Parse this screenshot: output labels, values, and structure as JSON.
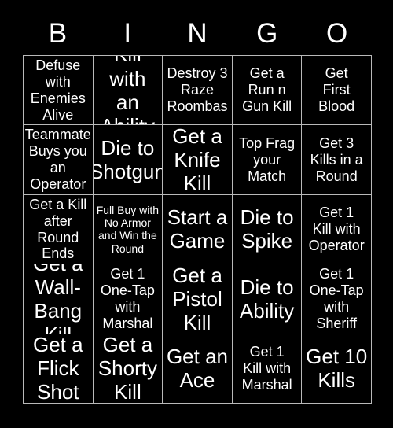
{
  "card": {
    "header_letters": [
      "B",
      "I",
      "N",
      "G",
      "O"
    ],
    "background_color": "#000000",
    "text_color": "#ffffff",
    "border_color": "#b9b9b9",
    "rows": 5,
    "columns": 5,
    "cells": [
      {
        "text": "Defuse\nwith\nEnemies\nAlive",
        "size": "sz-md"
      },
      {
        "text": "Kill with\nan\nAbility",
        "size": "sz-lg"
      },
      {
        "text": "Destroy 3\nRaze\nRoombas",
        "size": "sz-md"
      },
      {
        "text": "Get a\nRun n\nGun Kill",
        "size": "sz-md"
      },
      {
        "text": "Get\nFirst\nBlood",
        "size": "sz-md"
      },
      {
        "text": "Teammate\nBuys you\nan\nOperator",
        "size": "sz-md"
      },
      {
        "text": "Die to\nShotgun",
        "size": "sz-lg"
      },
      {
        "text": "Get a\nKnife\nKill",
        "size": "sz-lg"
      },
      {
        "text": "Top Frag\nyour\nMatch",
        "size": "sz-md"
      },
      {
        "text": "Get 3\nKills in a\nRound",
        "size": "sz-md"
      },
      {
        "text": "Get a Kill\nafter\nRound\nEnds",
        "size": "sz-md"
      },
      {
        "text": "Full Buy with\nNo Armor\nand Win the\nRound",
        "size": "sz-sm"
      },
      {
        "text": "Start a\nGame",
        "size": "sz-lg"
      },
      {
        "text": "Die to\nSpike",
        "size": "sz-lg"
      },
      {
        "text": "Get 1\nKill with\nOperator",
        "size": "sz-md"
      },
      {
        "text": "Get a\nWall-\nBang Kill",
        "size": "sz-lg"
      },
      {
        "text": "Get 1\nOne-Tap\nwith\nMarshal",
        "size": "sz-md"
      },
      {
        "text": "Get a\nPistol\nKill",
        "size": "sz-lg"
      },
      {
        "text": "Die to\nAbility",
        "size": "sz-lg"
      },
      {
        "text": "Get 1\nOne-Tap\nwith\nSheriff",
        "size": "sz-md"
      },
      {
        "text": "Get a\nFlick\nShot",
        "size": "sz-lg"
      },
      {
        "text": "Get a\nShorty\nKill",
        "size": "sz-lg"
      },
      {
        "text": "Get an\nAce",
        "size": "sz-lg"
      },
      {
        "text": "Get 1\nKill with\nMarshal",
        "size": "sz-md"
      },
      {
        "text": "Get 10\nKills",
        "size": "sz-lg"
      }
    ]
  }
}
